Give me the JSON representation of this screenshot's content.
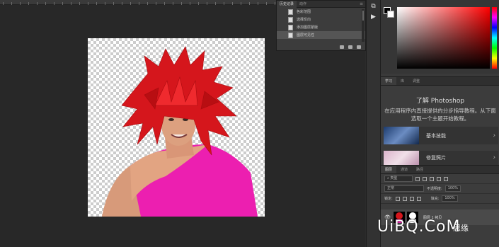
{
  "history_panel": {
    "tabs": [
      "历史记录",
      "动作"
    ],
    "items": [
      {
        "label": "色彩范围",
        "selected": false
      },
      {
        "label": "选择反向",
        "selected": false
      },
      {
        "label": "添加图层蒙版",
        "selected": false
      },
      {
        "label": "图层可见性",
        "selected": true
      }
    ]
  },
  "toolstrip": [
    "history-brush",
    "play"
  ],
  "color_panel": {
    "foreground": "#000000",
    "background": "#ffffff",
    "hue": "#ff0000"
  },
  "learn_panel": {
    "tabs": [
      "学习",
      "库",
      "调整"
    ],
    "title": "了解 Photoshop",
    "description": "在应用程序内直接提供的分步指导教程。从下面选取一个主题开始教程。",
    "cards": [
      {
        "label": "基本技能"
      },
      {
        "label": "修复照片"
      }
    ]
  },
  "layers_panel": {
    "tabs": [
      "图层",
      "通道",
      "路径"
    ],
    "filter_kind": "类型",
    "blend_mode": "正常",
    "opacity_label": "不透明度:",
    "opacity_value": "100%",
    "lock_label": "锁定:",
    "fill_label": "填充:",
    "fill_value": "100%",
    "layer": {
      "name": "图层 1 拷贝"
    }
  },
  "watermark": {
    "text": "UiBQ.CoM",
    "sub": "思缘"
  }
}
